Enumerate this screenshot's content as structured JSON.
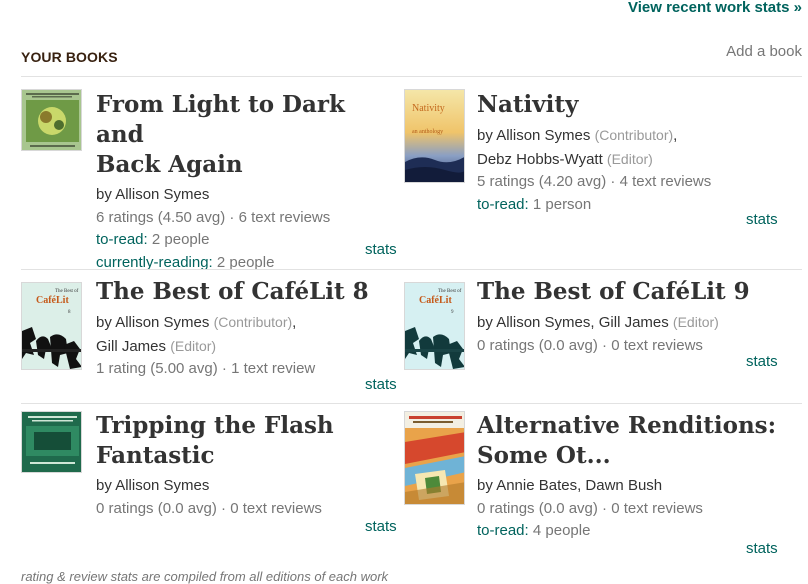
{
  "header": {
    "view_stats_link": "View recent work stats »",
    "section_title": "YOUR BOOKS",
    "add_book_link": "Add a book"
  },
  "books": [
    {
      "title_line1": "From Light to Dark and",
      "title_line2": "Back Again",
      "by": "by",
      "author1": "Allison Symes",
      "ratings": "6 ratings (4.50 avg) · 6 text reviews",
      "shelf1_label": "to-read:",
      "shelf1_value": " 2 people",
      "shelf2_label": "currently-reading:",
      "shelf2_value": " 2 people",
      "stats": "stats",
      "cover_text": "From Light to Dark and Back Again"
    },
    {
      "title_line1": "Nativity",
      "by": "by",
      "author1": "Allison Symes",
      "role1": "(Contributor)",
      "author2": "Debz Hobbs-Wyatt",
      "role2": "(Editor)",
      "ratings": "5 ratings (4.20 avg) · 4 text reviews",
      "shelf1_label": "to-read:",
      "shelf1_value": " 1 person",
      "stats": "stats",
      "cover_title": "Nativity",
      "cover_subtitle": "an anthology"
    },
    {
      "title_line1": "The Best of CaféLit 8",
      "by": "by",
      "author1": "Allison Symes",
      "role1": "(Contributor)",
      "author2": "Gill James",
      "role2": "(Editor)",
      "ratings": "1 rating (5.00 avg) · 1 text review",
      "stats": "stats",
      "cover_small": "The Best of",
      "cover_title": "CaféLit",
      "cover_number": "8"
    },
    {
      "title_line1": "The Best of CaféLit 9",
      "by": "by",
      "author1": "Allison Symes",
      "author2": "Gill James",
      "role2": "(Editor)",
      "ratings": "0 ratings (0.0 avg) · 0 text reviews",
      "stats": "stats",
      "cover_small": "The Best of",
      "cover_title": "CaféLit",
      "cover_number": "9"
    },
    {
      "title_line1": "Tripping the Flash",
      "title_line2": "Fantastic",
      "by": "by",
      "author1": "Allison Symes",
      "ratings": "0 ratings (0.0 avg) · 0 text reviews",
      "stats": "stats",
      "cover_text": "Tripping the Flash Fantastic"
    },
    {
      "title_line1": "Alternative Renditions:",
      "title_line2": "Some Ot...",
      "by": "by",
      "author1": "Annie Bates",
      "author2": "Dawn Bush",
      "ratings": "0 ratings (0.0 avg) · 0 text reviews",
      "shelf1_label": "to-read:",
      "shelf1_value": " 4 people",
      "stats": "stats",
      "cover_text": "Alternative Renditions"
    }
  ],
  "footnote": "rating & review stats are compiled from all editions of each work",
  "colors": {
    "link_green": "#00635d",
    "section_brown": "#382110",
    "muted_gray": "#767676",
    "role_gray": "#999999"
  }
}
